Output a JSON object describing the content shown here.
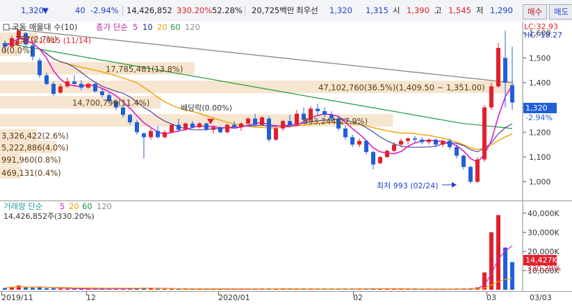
{
  "quote_bar": {
    "price": "1,320",
    "change_arrow": "▼",
    "change": "40",
    "change_pct": "-2.94%",
    "volume": "14,426,852",
    "volume_ratio": "330.20%",
    "turnover_pct": "52.28%",
    "trade_value": "20,725백만",
    "best_bid_label": "최우선",
    "best_ask": "1,320",
    "best_bid": "1,315",
    "open_label": "시",
    "open": "1,390",
    "high_label": "고",
    "high": "1,545",
    "low_label": "저",
    "low": "1,290",
    "buy_label": "매수",
    "sell_label": "매도"
  },
  "main_panel": {
    "title": "국동 매물대 수(10)",
    "ma_title": "종가 단순",
    "ma_periods": [
      "5",
      "10",
      "20",
      "60",
      "120"
    ],
    "lc": "LC:32.93",
    "hc": "HC:-18.27",
    "current_price": "1,320",
    "current_change": "-2.94%",
    "y_ticks": [
      "1,600",
      "1,500",
      "1,400",
      "1,300",
      "1,200",
      "1,100",
      "1,000"
    ],
    "max_label": "최고 1,615 (11/14)",
    "min_label": "최저 993 (02/24)",
    "dividend_label": "배당락(0.00%)",
    "volume_profile": [
      {
        "label": "257(2.7%)",
        "price": 1575
      },
      {
        "label": "0(0.0%)",
        "price": 1530
      },
      {
        "label": "17,785,481(13.8%)",
        "price": 1455
      },
      {
        "label": "47,102,760(36.5%)(1,409.50 ~ 1,351.00)",
        "price": 1380
      },
      {
        "label": "14,700,796(11.4%)",
        "price": 1318
      },
      {
        "label": "993,244(27.9%)",
        "price": 1245
      },
      {
        "label": "3,326,422(2.6%)",
        "price": 1185
      },
      {
        "label": "5,222,886(4.0%)",
        "price": 1138
      },
      {
        "label": "991,960(0.8%)",
        "price": 1088
      },
      {
        "label": "469,131(0.4%)",
        "price": 1035
      }
    ]
  },
  "volume_panel": {
    "title": "거래량 단순",
    "ma_periods": [
      "5",
      "20",
      "60",
      "120"
    ],
    "current_label": "14,426,852주(330.20%)",
    "y_ticks": [
      "40,000K",
      "30,000K",
      "20,000K",
      "10,000K"
    ],
    "last_value": "14,427K",
    "last_ratio": "330.20%"
  },
  "x_axis": {
    "labels": [
      "2019/11",
      "12",
      "2020/01",
      "02",
      "03",
      "03/03"
    ]
  },
  "colors": {
    "up": "#e0202c",
    "down": "#1f5fd8",
    "ma5": "#d61fc9",
    "ma10": "#2a2a9a",
    "ma20": "#f2a000",
    "ma60": "#1c9a3c",
    "ma120": "#8c8c8c",
    "profile": "#f5e1c8"
  },
  "chart_data": {
    "type": "candlestick",
    "y_range": [
      940,
      1630
    ],
    "volume_range_k": [
      0,
      45000
    ],
    "candles": [
      {
        "o": 1560,
        "h": 1570,
        "l": 1520,
        "c": 1545
      },
      {
        "o": 1545,
        "h": 1590,
        "l": 1540,
        "c": 1580
      },
      {
        "o": 1580,
        "h": 1615,
        "l": 1570,
        "c": 1610
      },
      {
        "o": 1600,
        "h": 1605,
        "l": 1540,
        "c": 1555
      },
      {
        "o": 1550,
        "h": 1560,
        "l": 1490,
        "c": 1505
      },
      {
        "o": 1490,
        "h": 1500,
        "l": 1420,
        "c": 1430
      },
      {
        "o": 1430,
        "h": 1440,
        "l": 1390,
        "c": 1395
      },
      {
        "o": 1395,
        "h": 1405,
        "l": 1345,
        "c": 1355
      },
      {
        "o": 1360,
        "h": 1395,
        "l": 1355,
        "c": 1385
      },
      {
        "o": 1385,
        "h": 1420,
        "l": 1380,
        "c": 1405
      },
      {
        "o": 1405,
        "h": 1430,
        "l": 1390,
        "c": 1395
      },
      {
        "o": 1395,
        "h": 1410,
        "l": 1370,
        "c": 1380
      },
      {
        "o": 1380,
        "h": 1400,
        "l": 1375,
        "c": 1395
      },
      {
        "o": 1395,
        "h": 1400,
        "l": 1360,
        "c": 1365
      },
      {
        "o": 1365,
        "h": 1375,
        "l": 1340,
        "c": 1350
      },
      {
        "o": 1350,
        "h": 1360,
        "l": 1320,
        "c": 1325
      },
      {
        "o": 1325,
        "h": 1330,
        "l": 1290,
        "c": 1300
      },
      {
        "o": 1300,
        "h": 1305,
        "l": 1260,
        "c": 1270
      },
      {
        "o": 1270,
        "h": 1275,
        "l": 1230,
        "c": 1240
      },
      {
        "o": 1240,
        "h": 1250,
        "l": 1190,
        "c": 1200
      },
      {
        "o": 1195,
        "h": 1200,
        "l": 1095,
        "c": 1180
      },
      {
        "o": 1180,
        "h": 1215,
        "l": 1170,
        "c": 1205
      },
      {
        "o": 1205,
        "h": 1225,
        "l": 1175,
        "c": 1180
      },
      {
        "o": 1180,
        "h": 1210,
        "l": 1175,
        "c": 1200
      },
      {
        "o": 1200,
        "h": 1235,
        "l": 1195,
        "c": 1230
      },
      {
        "o": 1230,
        "h": 1255,
        "l": 1200,
        "c": 1210
      },
      {
        "o": 1210,
        "h": 1240,
        "l": 1205,
        "c": 1235
      },
      {
        "o": 1235,
        "h": 1245,
        "l": 1215,
        "c": 1220
      },
      {
        "o": 1220,
        "h": 1240,
        "l": 1215,
        "c": 1235
      },
      {
        "o": 1235,
        "h": 1240,
        "l": 1205,
        "c": 1210
      },
      {
        "o": 1210,
        "h": 1225,
        "l": 1195,
        "c": 1220
      },
      {
        "o": 1220,
        "h": 1225,
        "l": 1195,
        "c": 1200
      },
      {
        "o": 1200,
        "h": 1235,
        "l": 1195,
        "c": 1230
      },
      {
        "o": 1230,
        "h": 1245,
        "l": 1215,
        "c": 1220
      },
      {
        "o": 1220,
        "h": 1240,
        "l": 1205,
        "c": 1235
      },
      {
        "o": 1235,
        "h": 1260,
        "l": 1230,
        "c": 1255
      },
      {
        "o": 1255,
        "h": 1275,
        "l": 1225,
        "c": 1230
      },
      {
        "o": 1230,
        "h": 1265,
        "l": 1225,
        "c": 1260
      },
      {
        "o": 1255,
        "h": 1265,
        "l": 1160,
        "c": 1170
      },
      {
        "o": 1170,
        "h": 1225,
        "l": 1165,
        "c": 1215
      },
      {
        "o": 1215,
        "h": 1250,
        "l": 1205,
        "c": 1245
      },
      {
        "o": 1245,
        "h": 1270,
        "l": 1225,
        "c": 1230
      },
      {
        "o": 1230,
        "h": 1290,
        "l": 1225,
        "c": 1275
      },
      {
        "o": 1275,
        "h": 1300,
        "l": 1240,
        "c": 1250
      },
      {
        "o": 1250,
        "h": 1305,
        "l": 1245,
        "c": 1295
      },
      {
        "o": 1295,
        "h": 1315,
        "l": 1270,
        "c": 1285
      },
      {
        "o": 1285,
        "h": 1300,
        "l": 1260,
        "c": 1270
      },
      {
        "o": 1270,
        "h": 1285,
        "l": 1245,
        "c": 1255
      },
      {
        "o": 1255,
        "h": 1265,
        "l": 1205,
        "c": 1215
      },
      {
        "o": 1215,
        "h": 1225,
        "l": 1170,
        "c": 1180
      },
      {
        "o": 1180,
        "h": 1190,
        "l": 1140,
        "c": 1150
      },
      {
        "o": 1150,
        "h": 1175,
        "l": 1140,
        "c": 1165
      },
      {
        "o": 1165,
        "h": 1170,
        "l": 1110,
        "c": 1120
      },
      {
        "o": 1120,
        "h": 1125,
        "l": 1050,
        "c": 1070
      },
      {
        "o": 1075,
        "h": 1105,
        "l": 1070,
        "c": 1100
      },
      {
        "o": 1100,
        "h": 1130,
        "l": 1095,
        "c": 1125
      },
      {
        "o": 1125,
        "h": 1160,
        "l": 1120,
        "c": 1150
      },
      {
        "o": 1150,
        "h": 1175,
        "l": 1140,
        "c": 1165
      },
      {
        "o": 1165,
        "h": 1180,
        "l": 1150,
        "c": 1175
      },
      {
        "o": 1175,
        "h": 1185,
        "l": 1160,
        "c": 1170
      },
      {
        "o": 1170,
        "h": 1180,
        "l": 1150,
        "c": 1160
      },
      {
        "o": 1160,
        "h": 1175,
        "l": 1150,
        "c": 1170
      },
      {
        "o": 1170,
        "h": 1175,
        "l": 1140,
        "c": 1150
      },
      {
        "o": 1150,
        "h": 1170,
        "l": 1140,
        "c": 1165
      },
      {
        "o": 1165,
        "h": 1175,
        "l": 1130,
        "c": 1140
      },
      {
        "o": 1140,
        "h": 1150,
        "l": 1095,
        "c": 1105
      },
      {
        "o": 1105,
        "h": 1110,
        "l": 1050,
        "c": 1060
      },
      {
        "o": 1060,
        "h": 1065,
        "l": 993,
        "c": 1000
      },
      {
        "o": 1000,
        "h": 1100,
        "l": 995,
        "c": 1090
      },
      {
        "o": 1090,
        "h": 1310,
        "l": 1080,
        "c": 1300
      },
      {
        "o": 1300,
        "h": 1400,
        "l": 1290,
        "c": 1385
      },
      {
        "o": 1385,
        "h": 1560,
        "l": 1380,
        "c": 1540
      },
      {
        "o": 1500,
        "h": 1610,
        "l": 1300,
        "c": 1400
      },
      {
        "o": 1390,
        "h": 1545,
        "l": 1290,
        "c": 1320
      }
    ],
    "volumes_k": [
      900,
      1500,
      2200,
      1200,
      1000,
      1400,
      800,
      700,
      600,
      500,
      500,
      400,
      400,
      450,
      500,
      450,
      500,
      600,
      700,
      900,
      1100,
      600,
      500,
      450,
      400,
      450,
      380,
      350,
      340,
      330,
      330,
      320,
      380,
      350,
      330,
      400,
      450,
      420,
      700,
      500,
      450,
      420,
      500,
      450,
      500,
      420,
      380,
      360,
      450,
      500,
      550,
      420,
      600,
      700,
      500,
      450,
      420,
      380,
      360,
      340,
      330,
      320,
      330,
      320,
      380,
      420,
      600,
      800,
      1200,
      9000,
      30000,
      39000,
      22000,
      14427
    ],
    "ma5_last": 1430,
    "ma10_last": 1290,
    "ma20_last": 1185,
    "ma60_last": 1215,
    "ma120_last": 1400
  }
}
